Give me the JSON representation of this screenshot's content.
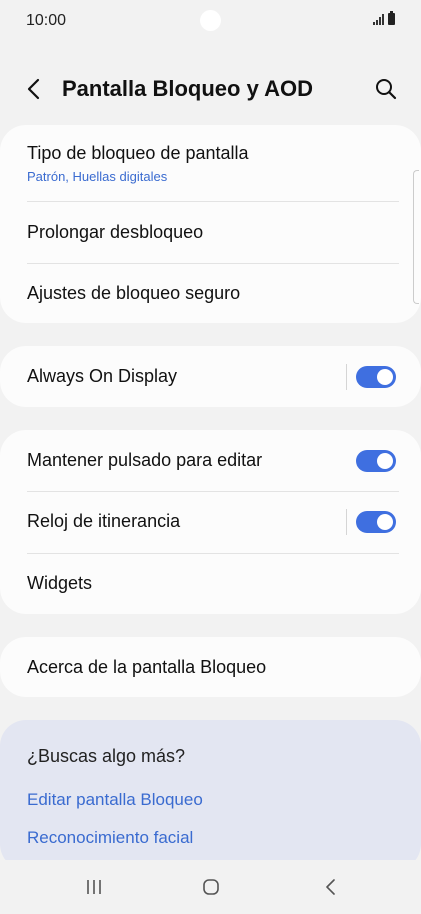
{
  "status_bar": {
    "time": "10:00"
  },
  "header": {
    "title": "Pantalla Bloqueo y AOD"
  },
  "card1": {
    "items": [
      {
        "label": "Tipo de bloqueo de pantalla",
        "sub": "Patrón, Huellas digitales"
      },
      {
        "label": "Prolongar desbloqueo"
      },
      {
        "label": "Ajustes de bloqueo seguro"
      }
    ]
  },
  "card2": {
    "items": [
      {
        "label": "Always On Display",
        "toggle": true
      }
    ]
  },
  "card3": {
    "items": [
      {
        "label": "Mantener pulsado para editar",
        "toggle": true
      },
      {
        "label": "Reloj de itinerancia",
        "toggle": true
      },
      {
        "label": "Widgets"
      }
    ]
  },
  "card4": {
    "items": [
      {
        "label": "Acerca de la pantalla Bloqueo"
      }
    ]
  },
  "suggestions": {
    "title": "¿Buscas algo más?",
    "links": [
      "Editar pantalla Bloqueo",
      "Reconocimiento facial"
    ]
  },
  "colors": {
    "accent": "#3f6fe0",
    "link": "#3a6bd0",
    "background": "#f2f2f2",
    "card": "#fcfcfc",
    "suggest_bg": "#e3e6f2"
  },
  "icons": [
    "back-icon",
    "search-icon",
    "recents-icon",
    "home-icon",
    "nav-back-icon",
    "signal-icon",
    "battery-icon"
  ]
}
